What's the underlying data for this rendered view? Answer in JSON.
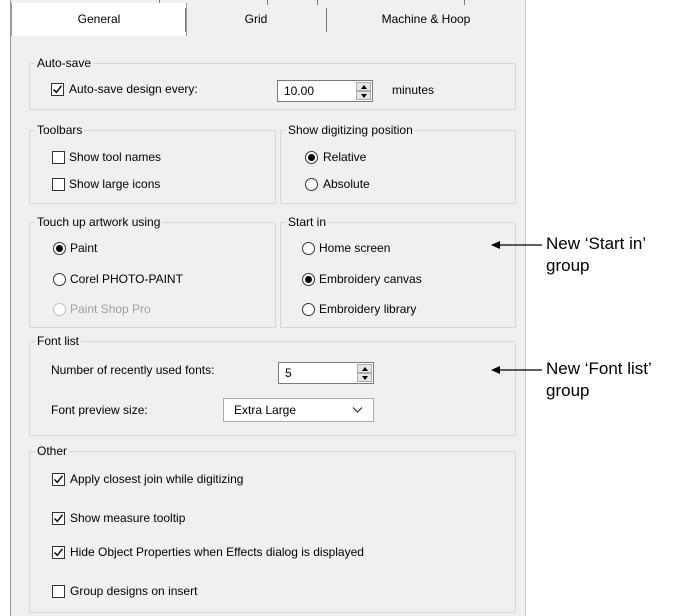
{
  "tabs": [
    {
      "label": "General",
      "active": true
    },
    {
      "label": "Grid",
      "active": false
    },
    {
      "label": "Machine & Hoop",
      "active": false
    }
  ],
  "autosave": {
    "legend": "Auto-save",
    "checkbox_label": "Auto-save design every:",
    "checked": true,
    "value": "10.00",
    "unit": "minutes"
  },
  "toolbars": {
    "legend": "Toolbars",
    "show_tool_names": {
      "label": "Show tool names",
      "checked": false
    },
    "show_large_icons": {
      "label": "Show large icons",
      "checked": false
    }
  },
  "digitizing_position": {
    "legend": "Show digitizing position",
    "options": [
      {
        "label": "Relative",
        "selected": true
      },
      {
        "label": "Absolute",
        "selected": false
      }
    ]
  },
  "touch_up": {
    "legend": "Touch up artwork using",
    "options": [
      {
        "label": "Paint",
        "selected": true,
        "disabled": false
      },
      {
        "label": "Corel PHOTO-PAINT",
        "selected": false,
        "disabled": false
      },
      {
        "label": "Paint Shop Pro",
        "selected": false,
        "disabled": true
      }
    ]
  },
  "start_in": {
    "legend": "Start in",
    "options": [
      {
        "label": "Home screen",
        "selected": false
      },
      {
        "label": "Embroidery canvas",
        "selected": true
      },
      {
        "label": "Embroidery library",
        "selected": false
      }
    ]
  },
  "font_list": {
    "legend": "Font list",
    "recent_label": "Number of recently used fonts:",
    "recent_value": "5",
    "preview_label": "Font preview size:",
    "preview_value": "Extra Large"
  },
  "other": {
    "legend": "Other",
    "items": [
      {
        "label": "Apply closest join while digitizing",
        "checked": true
      },
      {
        "label": "Show measure tooltip",
        "checked": true
      },
      {
        "label": "Hide Object Properties when Effects dialog is displayed",
        "checked": true
      },
      {
        "label": "Group designs on insert",
        "checked": false
      }
    ]
  },
  "callouts": {
    "start_in": {
      "line1": "New ‘Start in’",
      "line2": "group"
    },
    "font_list": {
      "line1": "New ‘Font list’",
      "line2": "group"
    }
  },
  "colors": {
    "panel_bg": "#f0f0f0",
    "group_border": "#d5d5d5",
    "disabled_text": "#a0a0a0"
  }
}
